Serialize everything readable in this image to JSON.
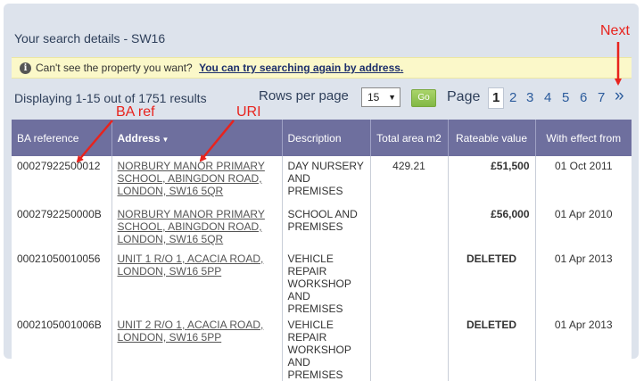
{
  "search": {
    "title": "Your search details - SW16"
  },
  "notice": {
    "icon": "info-icon",
    "text": "Can't see the property you want?",
    "link": "You can try searching again by address."
  },
  "results": {
    "displaying": "Displaying 1-15 out of 1751 results",
    "rows_label": "Rows per page",
    "rows_value": "15",
    "go_label": "Go",
    "page_label": "Page",
    "pages": [
      "1",
      "2",
      "3",
      "4",
      "5",
      "6",
      "7"
    ],
    "current_page": "1",
    "next": "»"
  },
  "annotations": {
    "ba_ref": "BA ref",
    "uri": "URI",
    "next": "Next",
    "color": "#e8231d"
  },
  "table": {
    "headers": {
      "ba": "BA reference",
      "address": "Address",
      "description": "Description",
      "area": "Total area m2",
      "rv": "Rateable value",
      "effect": "With effect from"
    },
    "rows": [
      {
        "ba": "00027922500012",
        "addr": [
          "NORBURY MANOR PRIMARY",
          "SCHOOL, ABINGDON ROAD,",
          "LONDON, SW16 5QR"
        ],
        "desc": [
          "DAY NURSERY",
          "AND PREMISES"
        ],
        "area": "429.21",
        "rv": "£51,500",
        "date": "01 Oct 2011"
      },
      {
        "ba": "0002792250000B",
        "addr": [
          "NORBURY MANOR PRIMARY",
          "SCHOOL, ABINGDON ROAD,",
          "LONDON, SW16 5QR"
        ],
        "desc": [
          "SCHOOL AND",
          "PREMISES"
        ],
        "area": "",
        "rv": "£56,000",
        "date": "01 Apr 2010"
      },
      {
        "ba": "00021050010056",
        "addr": [
          "UNIT 1 R/O 1, ACACIA ROAD,",
          "LONDON, SW16 5PP"
        ],
        "desc": [
          "VEHICLE",
          "REPAIR",
          "WORKSHOP",
          "AND PREMISES"
        ],
        "area": "",
        "rv": "DELETED",
        "date": "01 Apr 2013"
      },
      {
        "ba": "0002105001006B",
        "addr": [
          "UNIT 2 R/O 1, ACACIA ROAD,",
          "LONDON, SW16 5PP"
        ],
        "desc": [
          "VEHICLE",
          "REPAIR",
          "WORKSHOP",
          "AND PREMISES"
        ],
        "area": "",
        "rv": "DELETED",
        "date": "01 Apr 2013"
      }
    ]
  }
}
